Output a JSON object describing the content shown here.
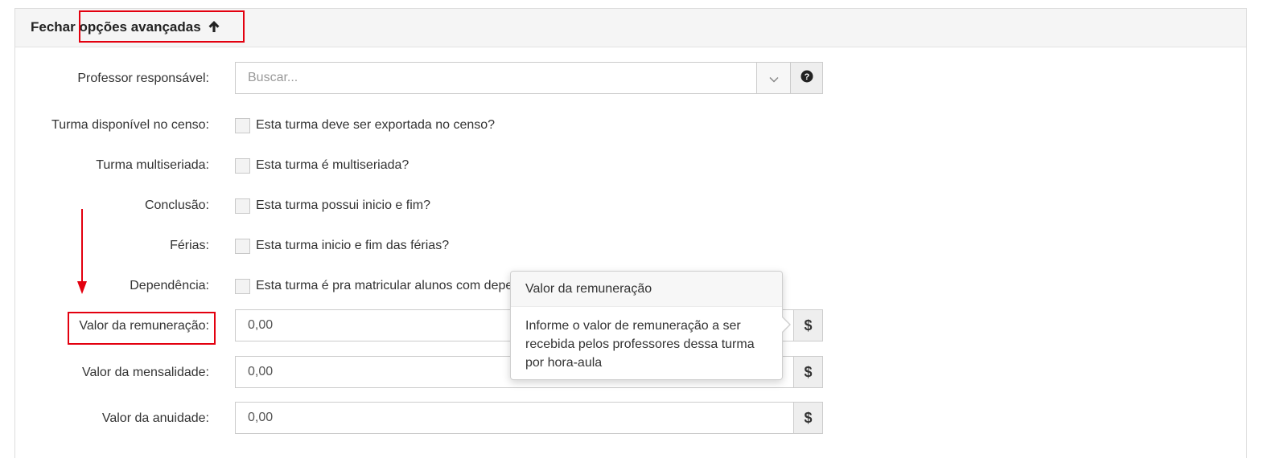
{
  "header": {
    "title_prefix": "Fechar",
    "title_main": "opções avançadas",
    "arrow_icon": "arrow-up-icon"
  },
  "form": {
    "professor": {
      "label": "Professor responsável:",
      "placeholder": "Buscar...",
      "dropdown_icon": "chevron-down-icon",
      "help_icon": "question-circle-icon"
    },
    "censo": {
      "label": "Turma disponível no censo:",
      "checkbox_label": "Esta turma deve ser exportada no censo?",
      "checked": false
    },
    "multiseriada": {
      "label": "Turma multiseriada:",
      "checkbox_label": "Esta turma é multiseriada?",
      "checked": false
    },
    "conclusao": {
      "label": "Conclusão:",
      "checkbox_label": "Esta turma possui inicio e fim?",
      "checked": false
    },
    "ferias": {
      "label": "Férias:",
      "checkbox_label": "Esta turma inicio e fim das férias?",
      "checked": false
    },
    "dependencia": {
      "label": "Dependência:",
      "checkbox_label": "Esta turma é pra matricular alunos com depe",
      "checked": false
    },
    "remuneracao": {
      "label": "Valor da remuneração:",
      "value": "0,00",
      "addon": "$"
    },
    "mensalidade": {
      "label": "Valor da mensalidade:",
      "value": "0,00",
      "addon": "$"
    },
    "anuidade": {
      "label": "Valor da anuidade:",
      "value": "0,00",
      "addon": "$"
    }
  },
  "popover": {
    "title": "Valor da remuneração",
    "body": "Informe o valor de remuneração a ser recebida pelos professores dessa turma por hora-aula"
  },
  "annotations": {
    "color": "#e3000f"
  }
}
